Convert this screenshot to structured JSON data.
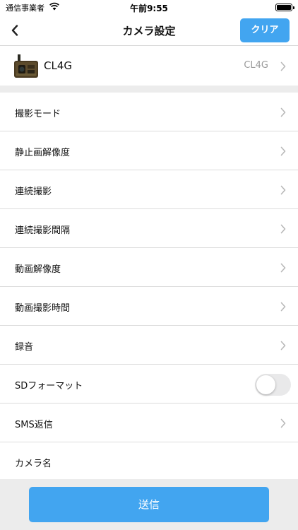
{
  "status_bar": {
    "carrier": "通信事業者",
    "time": "午前9:55"
  },
  "nav": {
    "title": "カメラ設定",
    "clear_label": "クリア"
  },
  "camera": {
    "name": "CL4G",
    "model": "CL4G"
  },
  "settings": {
    "items": [
      {
        "label": "撮影モード"
      },
      {
        "label": "静止画解像度"
      },
      {
        "label": "連続撮影"
      },
      {
        "label": "連続撮影間隔"
      },
      {
        "label": "動画解像度"
      },
      {
        "label": "動画撮影時間"
      },
      {
        "label": "録音"
      },
      {
        "label": "SDフォーマット",
        "toggle_on": false
      },
      {
        "label": "SMS返信"
      },
      {
        "label": "カメラ名"
      }
    ]
  },
  "footer": {
    "send_label": "送信"
  },
  "colors": {
    "accent": "#42a5f0",
    "separator": "#dcdcdc",
    "section_bg": "#ececec",
    "secondary_text": "#9a9a9a"
  }
}
